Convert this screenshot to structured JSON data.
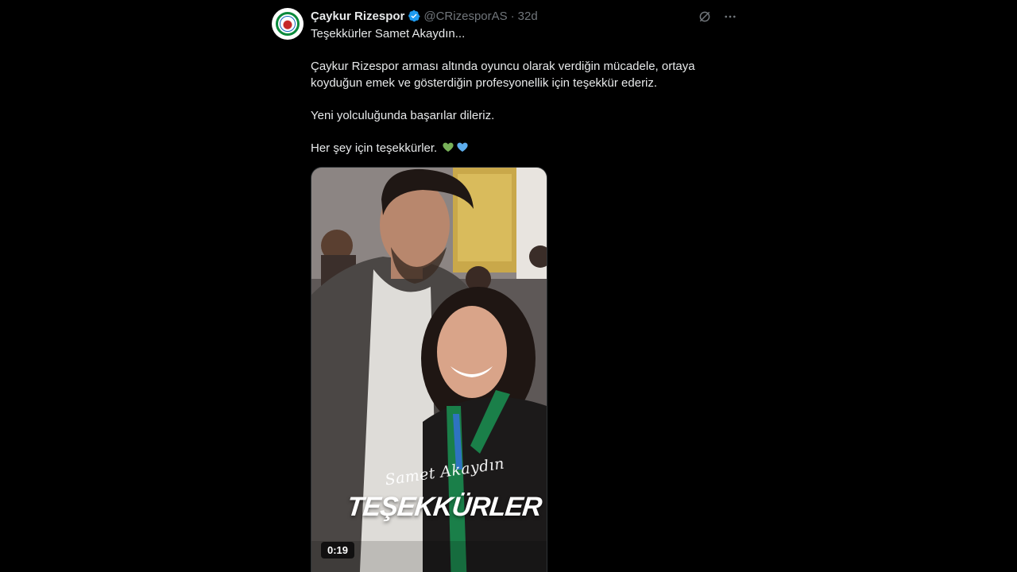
{
  "tweet": {
    "display_name": "Çaykur Rizespor",
    "handle": "@CRizesporAS",
    "separator": "·",
    "time": "32d",
    "paragraphs": [
      "Teşekkürler Samet Akaydın...",
      "Çaykur Rizespor arması altında oyuncu olarak verdiğin mücadele, ortaya koyduğun emek ve gösterdiğin profesyonellik için teşekkür ederiz.",
      "Yeni yolculuğunda başarılar dileriz.",
      "Her şey için teşekkürler."
    ],
    "emoji_hearts": [
      "green-heart",
      "blue-heart"
    ]
  },
  "media": {
    "video_duration": "0:19",
    "overlay_script": "Samet Akaydın",
    "overlay_title": "TEŞEKKÜRLER"
  },
  "icons": {
    "verified": "verified-badge-icon",
    "grok": "grok-icon",
    "more": "more-icon"
  },
  "colors": {
    "background": "#000000",
    "text_primary": "#e7e9ea",
    "text_secondary": "#71767b",
    "verified_blue": "#1d9bf0",
    "heart_green": "#78b159",
    "heart_blue": "#5dadec"
  }
}
